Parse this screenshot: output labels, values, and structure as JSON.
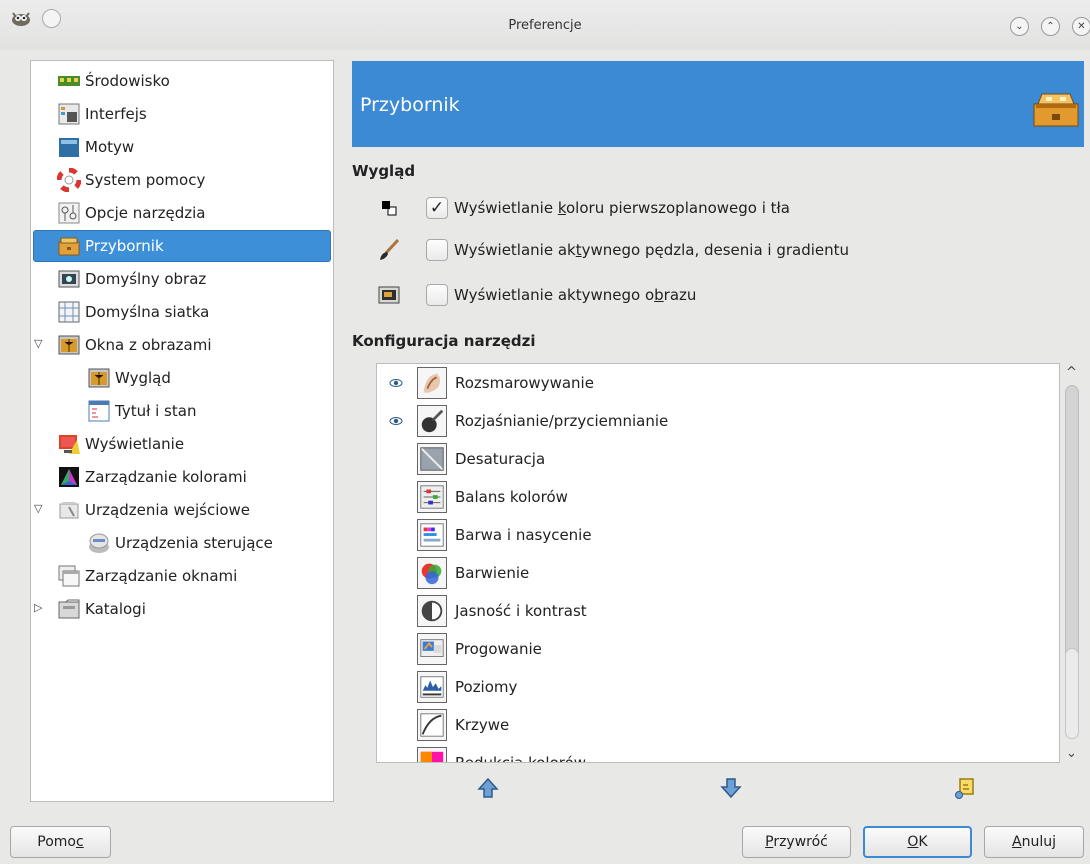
{
  "window": {
    "title": "Preferencje"
  },
  "sidebar": {
    "items": [
      {
        "label": "Środowisko",
        "icon": "environment-icon"
      },
      {
        "label": "Interfejs",
        "icon": "interface-icon"
      },
      {
        "label": "Motyw",
        "icon": "theme-icon"
      },
      {
        "label": "System pomocy",
        "icon": "help-lifebuoy-icon"
      },
      {
        "label": "Opcje narzędzia",
        "icon": "tool-options-icon"
      },
      {
        "label": "Przybornik",
        "icon": "toolbox-icon",
        "selected": true
      },
      {
        "label": "Domyślny obraz",
        "icon": "default-image-icon"
      },
      {
        "label": "Domyślna siatka",
        "icon": "default-grid-icon"
      },
      {
        "label": "Okna z obrazami",
        "icon": "image-windows-icon",
        "expanded": true
      },
      {
        "label": "Wygląd",
        "icon": "appearance-icon"
      },
      {
        "label": "Tytuł i stan",
        "icon": "title-status-icon"
      },
      {
        "label": "Wyświetlanie",
        "icon": "display-icon"
      },
      {
        "label": "Zarządzanie kolorami",
        "icon": "color-management-icon"
      },
      {
        "label": "Urządzenia wejściowe",
        "icon": "input-devices-icon",
        "expanded": true
      },
      {
        "label": "Urządzenia sterujące",
        "icon": "input-controllers-icon"
      },
      {
        "label": "Zarządzanie oknami",
        "icon": "window-management-icon"
      },
      {
        "label": "Katalogi",
        "icon": "folders-icon",
        "expanded": false
      }
    ]
  },
  "header": {
    "title": "Przybornik"
  },
  "appearance": {
    "title": "Wygląd",
    "options": [
      {
        "pre": "Wyświetlanie ",
        "mn": "k",
        "post": "oloru pierwszoplanowego i tła",
        "checked": true,
        "icon": "fg-bg-color-icon"
      },
      {
        "pre": "Wyświetlanie ak",
        "mn": "t",
        "post": "ywnego pędzla, desenia i gradientu",
        "checked": false,
        "icon": "brush-icon"
      },
      {
        "pre": "Wyświetlanie aktywnego o",
        "mn": "b",
        "post": "razu",
        "checked": false,
        "icon": "active-image-icon"
      }
    ]
  },
  "tools_config": {
    "title": "Konfiguracja narzędzi",
    "tools": [
      {
        "name": "Rozsmarowywanie",
        "visible": true,
        "icon": "smudge-icon"
      },
      {
        "name": "Rozjaśnianie/przyciemnianie",
        "visible": true,
        "icon": "dodge-burn-icon"
      },
      {
        "name": "Desaturacja",
        "visible": false,
        "icon": "desaturate-icon"
      },
      {
        "name": "Balans kolorów",
        "visible": false,
        "icon": "color-balance-icon"
      },
      {
        "name": "Barwa i nasycenie",
        "visible": false,
        "icon": "hue-saturation-icon"
      },
      {
        "name": "Barwienie",
        "visible": false,
        "icon": "colorize-icon"
      },
      {
        "name": "Jasność i kontrast",
        "visible": false,
        "icon": "brightness-contrast-icon"
      },
      {
        "name": "Progowanie",
        "visible": false,
        "icon": "threshold-icon"
      },
      {
        "name": "Poziomy",
        "visible": false,
        "icon": "levels-icon"
      },
      {
        "name": "Krzywe",
        "visible": false,
        "icon": "curves-icon"
      },
      {
        "name": "Redukcja kolorów",
        "visible": false,
        "icon": "posterize-icon"
      }
    ]
  },
  "buttons": {
    "help": {
      "pre": "Pomo",
      "mn": "c",
      "post": ""
    },
    "reset": {
      "pre": "",
      "mn": "P",
      "post": "rzywróć"
    },
    "ok": {
      "pre": "",
      "mn": "O",
      "post": "K"
    },
    "cancel": {
      "pre": "",
      "mn": "A",
      "post": "nuluj"
    }
  },
  "colors": {
    "accent": "#3b8ad3",
    "background": "#e8e8e7"
  }
}
